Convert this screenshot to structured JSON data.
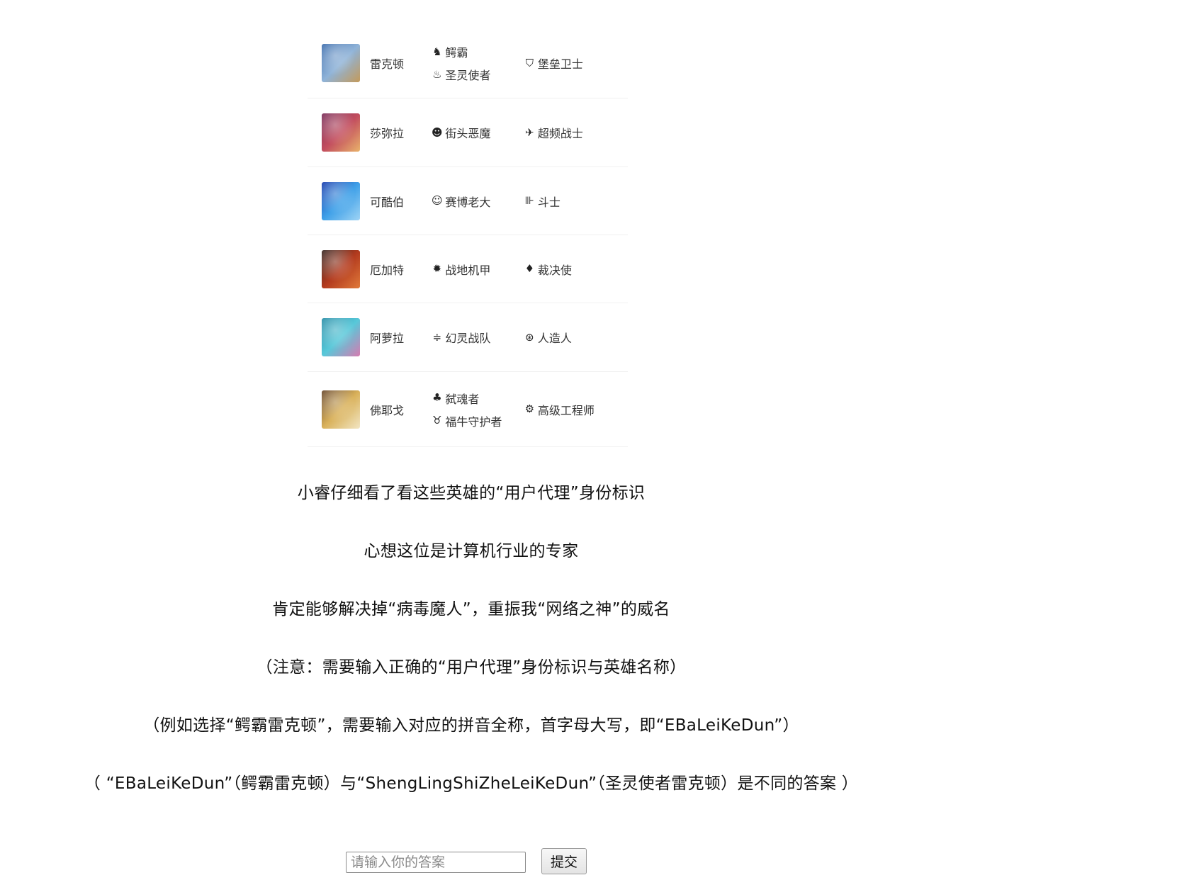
{
  "champions": [
    {
      "name": "雷克顿",
      "avatar_colors": [
        "#3f6fae",
        "#8fb3d8",
        "#c49a5a"
      ],
      "origins": [
        {
          "icon": "crocodile-icon",
          "glyph": "♞",
          "label": "鳄霸"
        },
        {
          "icon": "spirit-flame-icon",
          "glyph": "♨",
          "label": "圣灵使者"
        }
      ],
      "classes": [
        {
          "icon": "bastion-shield-icon",
          "glyph": "⛉",
          "label": "堡垒卫士"
        }
      ]
    },
    {
      "name": "莎弥拉",
      "avatar_colors": [
        "#7b2f5a",
        "#c24d5e",
        "#e9b36b"
      ],
      "origins": [
        {
          "icon": "street-demon-icon",
          "glyph": "☻",
          "label": "街头恶魔"
        }
      ],
      "classes": [
        {
          "icon": "hyper-hand-icon",
          "glyph": "✈",
          "label": "超频战士"
        }
      ]
    },
    {
      "name": "可酷伯",
      "avatar_colors": [
        "#1c3fae",
        "#3fa0e8",
        "#9fd4f5"
      ],
      "origins": [
        {
          "icon": "cyber-boss-icon",
          "glyph": "☺",
          "label": "赛博老大"
        }
      ],
      "classes": [
        {
          "icon": "dumbbell-icon",
          "glyph": "⊪",
          "label": "斗士"
        }
      ]
    },
    {
      "name": "厄加特",
      "avatar_colors": [
        "#3a2a26",
        "#b23a1e",
        "#e07a3a"
      ],
      "origins": [
        {
          "icon": "mecha-gear-icon",
          "glyph": "✹",
          "label": "战地机甲"
        }
      ],
      "classes": [
        {
          "icon": "executioner-icon",
          "glyph": "♦",
          "label": "裁决使"
        }
      ]
    },
    {
      "name": "阿萝拉",
      "avatar_colors": [
        "#2b8fa8",
        "#58c8d9",
        "#d77ab0"
      ],
      "origins": [
        {
          "icon": "phantom-squad-icon",
          "glyph": "≑",
          "label": "幻灵战队"
        }
      ],
      "classes": [
        {
          "icon": "ai-swirl-icon",
          "glyph": "⊛",
          "label": "人造人"
        }
      ]
    },
    {
      "name": "佛耶戈",
      "avatar_colors": [
        "#6b4a2e",
        "#d9b15a",
        "#f2e6c4"
      ],
      "origins": [
        {
          "icon": "soul-killer-icon",
          "glyph": "♣",
          "label": "弑魂者"
        },
        {
          "icon": "ox-guardian-icon",
          "glyph": "♉",
          "label": "福牛守护者"
        }
      ],
      "classes": [
        {
          "icon": "engineer-icon",
          "glyph": "⚙",
          "label": "高级工程师"
        }
      ]
    }
  ],
  "story_lines": [
    "小睿仔细看了看这些英雄的“用户代理”身份标识",
    "心想这位是计算机行业的专家",
    "肯定能够解决掉“病毒魔人”，重振我“网络之神”的威名",
    "（注意：需要输入正确的“用户代理”身份标识与英雄名称）",
    "（例如选择“鳄霸雷克顿”，需要输入对应的拼音全称，首字母大写，即“EBaLeiKeDun”）",
    "（ “EBaLeiKeDun”（鳄霸雷克顿）与“ShengLingShiZheLeiKeDun”（圣灵使者雷克顿）是不同的答案 ）"
  ],
  "answer": {
    "placeholder": "请输入你的答案",
    "value": ""
  },
  "submit_label": "提交"
}
